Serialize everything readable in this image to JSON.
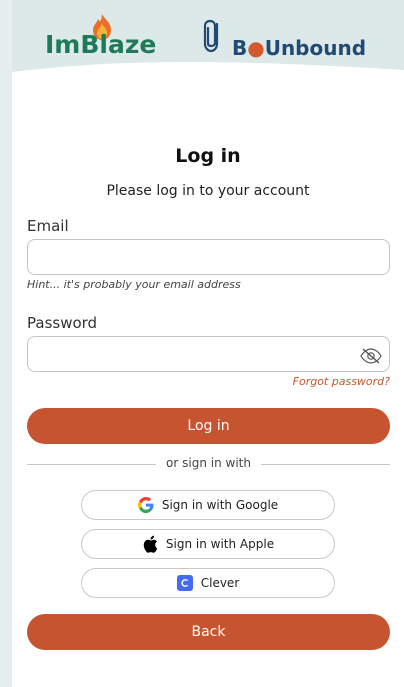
{
  "header": {
    "brand_left": "ImBlaze",
    "brand_right_prefix": "B",
    "brand_right_dot": "●",
    "brand_right_suffix": "Unbound"
  },
  "title": "Log in",
  "subtitle": "Please log in to your account",
  "email": {
    "label": "Email",
    "value": "",
    "hint": "Hint... it's probably your email address"
  },
  "password": {
    "label": "Password",
    "value": "",
    "forgot": "Forgot password?"
  },
  "login_button": "Log in",
  "divider": "or sign in with",
  "social": {
    "google": "Sign in with Google",
    "apple": "Sign in with Apple",
    "clever": "Clever"
  },
  "back_button": "Back",
  "colors": {
    "accent": "#c65430",
    "brand_green": "#1f7a5a",
    "brand_blue": "#1f4a73",
    "header_bg": "#dde8e9",
    "link": "#c2552f"
  },
  "icons": {
    "flame": "flame-icon",
    "paperclip": "paperclip-icon",
    "eye": "eye-slash-icon",
    "google": "google-icon",
    "apple": "apple-icon",
    "clever": "clever-icon"
  }
}
